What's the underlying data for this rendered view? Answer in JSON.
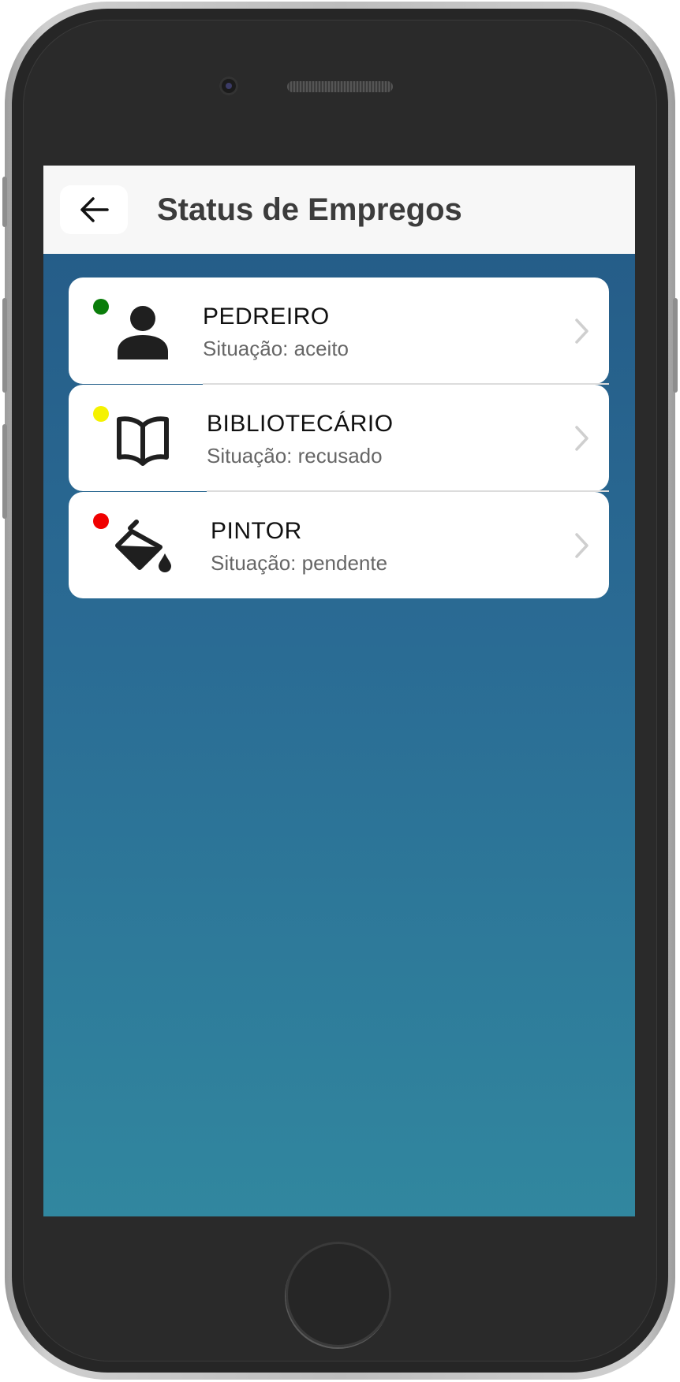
{
  "header": {
    "title": "Status de Empregos",
    "back_icon": "arrow-left-icon"
  },
  "jobs": [
    {
      "title": "PEDREIRO",
      "status": "Situação: aceito",
      "status_color": "#0a7d0a",
      "icon": "person-icon"
    },
    {
      "title": "BIBLIOTECÁRIO",
      "status": "Situação: recusado",
      "status_color": "#f5f200",
      "icon": "book-open-icon"
    },
    {
      "title": "PINTOR",
      "status": "Situação: pendente",
      "status_color": "#f00000",
      "icon": "paint-bucket-icon"
    }
  ],
  "colors": {
    "header_background": "#f7f7f7",
    "screen_gradient_top": "#245a86",
    "screen_gradient_bottom": "#31879f",
    "card_background": "#ffffff"
  }
}
